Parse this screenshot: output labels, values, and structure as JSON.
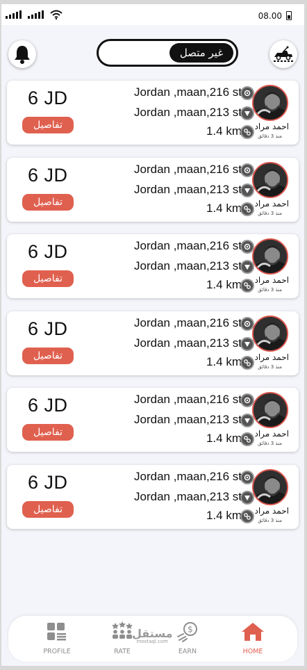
{
  "status_bar": {
    "time": "08.00"
  },
  "header": {
    "status_toggle_label": "غير متصل",
    "notification_icon": "bell-icon",
    "vehicle_icon": "tow-truck-icon"
  },
  "trips": [
    {
      "price": "6 JD",
      "details_label": "تفاصيل",
      "pickup": "Jordan ,maan,216 st",
      "dropoff": "Jordan ,maan,213 st",
      "distance": "1.4 km",
      "driver_name": "احمد مراد",
      "time_ago": "منذ 3 دقائق"
    },
    {
      "price": "6 JD",
      "details_label": "تفاصيل",
      "pickup": "Jordan ,maan,216 st",
      "dropoff": "Jordan ,maan,213 st",
      "distance": "1.4 km",
      "driver_name": "احمد مراد",
      "time_ago": "منذ 3 دقائق"
    },
    {
      "price": "6 JD",
      "details_label": "تفاصيل",
      "pickup": "Jordan ,maan,216 st",
      "dropoff": "Jordan ,maan,213 st",
      "distance": "1.4 km",
      "driver_name": "احمد مراد",
      "time_ago": "منذ 3 دقائق"
    },
    {
      "price": "6 JD",
      "details_label": "تفاصيل",
      "pickup": "Jordan ,maan,216 st",
      "dropoff": "Jordan ,maan,213 st",
      "distance": "1.4 km",
      "driver_name": "احمد مراد",
      "time_ago": "منذ 3 دقائق"
    },
    {
      "price": "6 JD",
      "details_label": "تفاصيل",
      "pickup": "Jordan ,maan,216 st",
      "dropoff": "Jordan ,maan,213 st",
      "distance": "1.4 km",
      "driver_name": "احمد مراد",
      "time_ago": "منذ 3 دقائق"
    },
    {
      "price": "6 JD",
      "details_label": "تفاصيل",
      "pickup": "Jordan ,maan,216 st",
      "dropoff": "Jordan ,maan,213 st",
      "distance": "1.4 km",
      "driver_name": "احمد مراد",
      "time_ago": "منذ 3 دقائق"
    }
  ],
  "bottom_nav": {
    "items": [
      {
        "label": "PROFILE",
        "icon": "profile-grid-icon"
      },
      {
        "label": "RATE",
        "icon": "rate-stars-icon"
      },
      {
        "label": "EARN",
        "icon": "earn-coin-icon"
      },
      {
        "label": "HOME",
        "icon": "home-icon",
        "active": true
      }
    ],
    "watermark": "مستقل",
    "watermark_sub": "mostaql.com"
  },
  "colors": {
    "accent": "#e0604f",
    "background": "#f4f5fa",
    "card": "#ffffff",
    "dark": "#111111"
  }
}
